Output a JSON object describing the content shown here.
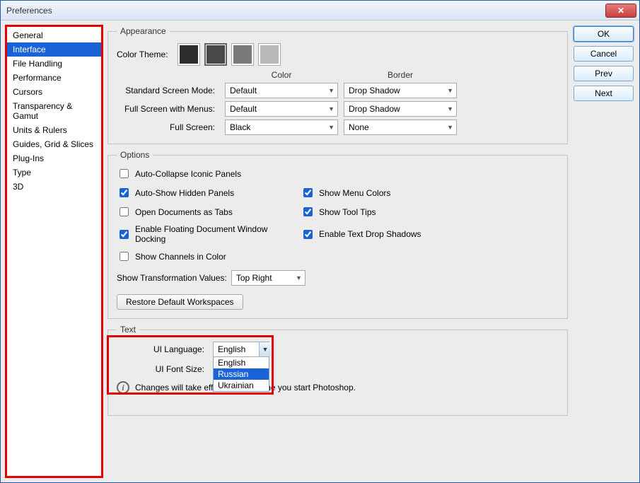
{
  "window": {
    "title": "Preferences"
  },
  "sidebar": {
    "selected_index": 1,
    "items": [
      "General",
      "Interface",
      "File Handling",
      "Performance",
      "Cursors",
      "Transparency & Gamut",
      "Units & Rulers",
      "Guides, Grid & Slices",
      "Plug-Ins",
      "Type",
      "3D"
    ]
  },
  "buttons": {
    "ok": "OK",
    "cancel": "Cancel",
    "prev": "Prev",
    "next": "Next"
  },
  "appearance": {
    "legend": "Appearance",
    "color_theme_label": "Color Theme:",
    "swatches": [
      "#2e2e2e",
      "#494949",
      "#7a7a7a",
      "#b8b8b8"
    ],
    "selected_swatch": 1,
    "header_color": "Color",
    "header_border": "Border",
    "rows": [
      {
        "label": "Standard Screen Mode:",
        "color": "Default",
        "border": "Drop Shadow"
      },
      {
        "label": "Full Screen with Menus:",
        "color": "Default",
        "border": "Drop Shadow"
      },
      {
        "label": "Full Screen:",
        "color": "Black",
        "border": "None"
      }
    ]
  },
  "options": {
    "legend": "Options",
    "checks": {
      "auto_collapse": {
        "label": "Auto-Collapse Iconic Panels",
        "checked": false
      },
      "auto_show": {
        "label": "Auto-Show Hidden Panels",
        "checked": true
      },
      "open_tabs": {
        "label": "Open Documents as Tabs",
        "checked": false
      },
      "floating": {
        "label": "Enable Floating Document Window Docking",
        "checked": true
      },
      "channels_color": {
        "label": "Show Channels in Color",
        "checked": false
      },
      "menu_colors": {
        "label": "Show Menu Colors",
        "checked": true
      },
      "tool_tips": {
        "label": "Show Tool Tips",
        "checked": true
      },
      "text_shadows": {
        "label": "Enable Text Drop Shadows",
        "checked": true
      }
    },
    "transform_label": "Show Transformation Values:",
    "transform_value": "Top Right",
    "restore": "Restore Default Workspaces"
  },
  "text": {
    "legend": "Text",
    "lang_label": "UI Language:",
    "lang_value": "English",
    "lang_options": [
      "English",
      "Russian",
      "Ukrainian"
    ],
    "lang_highlighted": 1,
    "size_label": "UI Font Size:",
    "info": "Changes will take effect the next time you start Photoshop."
  }
}
